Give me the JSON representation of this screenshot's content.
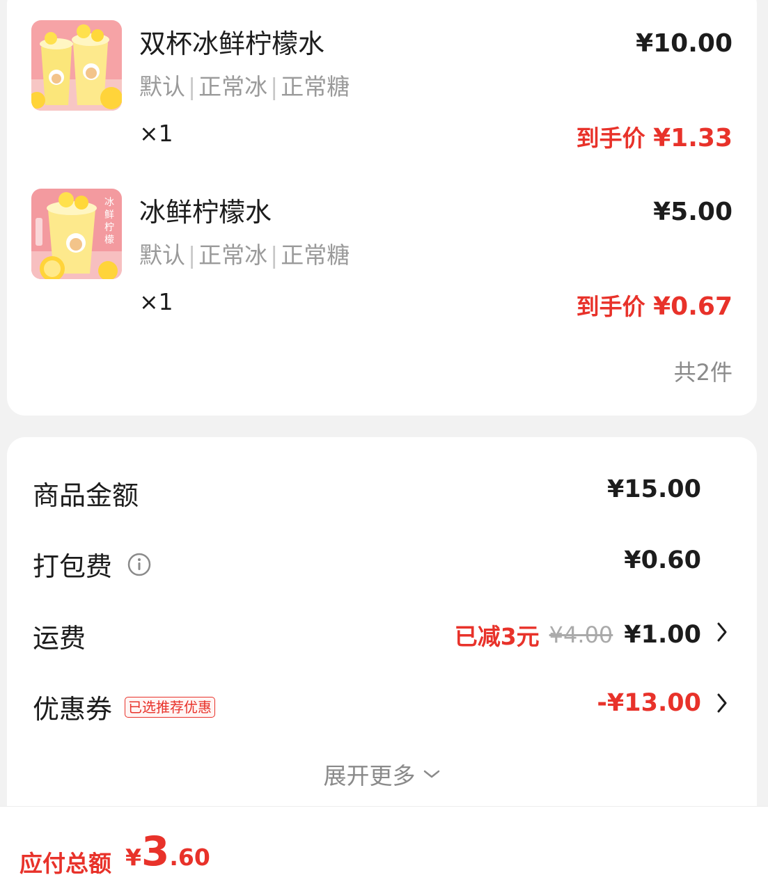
{
  "items": [
    {
      "name": "双杯冰鲜柠檬水",
      "specs": [
        "默认",
        "正常冰",
        "正常糖"
      ],
      "qty": "×1",
      "price": "¥10.00",
      "final_label": "到手价",
      "final_price": "¥1.33"
    },
    {
      "name": "冰鲜柠檬水",
      "specs": [
        "默认",
        "正常冰",
        "正常糖"
      ],
      "qty": "×1",
      "price": "¥5.00",
      "final_label": "到手价",
      "final_price": "¥0.67",
      "image_text": "冰鲜柠檬"
    }
  ],
  "total_count": "共2件",
  "fees": {
    "goods": {
      "label": "商品金额",
      "value": "¥15.00"
    },
    "packing": {
      "label": "打包费",
      "value": "¥0.60",
      "icon": "info-icon"
    },
    "delivery": {
      "label": "运费",
      "discount": "已减3元",
      "original": "¥4.00",
      "value": "¥1.00",
      "icon": "chevron-right-icon"
    },
    "coupon": {
      "label": "优惠券",
      "tag": "已选推荐优惠",
      "value": "-¥13.00",
      "icon": "chevron-right-icon"
    },
    "expand_label": "展开更多",
    "expand_icon": "chevron-down-icon"
  },
  "bottom": {
    "pay_label": "应付总额",
    "currency": "¥",
    "amount_int": "3",
    "amount_dec": ".60"
  },
  "colors": {
    "accent_red": "#e8322a",
    "background": "#f2f2f2",
    "muted": "#9a9a9a"
  }
}
